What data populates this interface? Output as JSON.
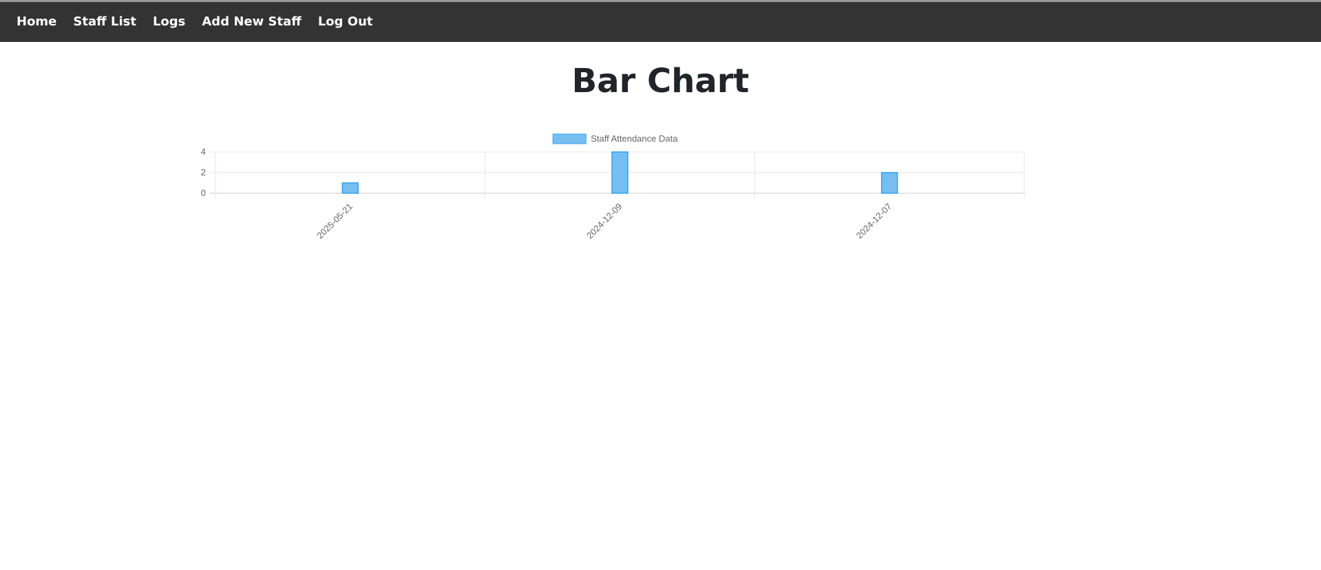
{
  "nav": {
    "items": [
      {
        "id": "home",
        "label": "Home"
      },
      {
        "id": "staff-list",
        "label": "Staff List"
      },
      {
        "id": "logs",
        "label": "Logs"
      },
      {
        "id": "add-new-staff",
        "label": "Add New Staff"
      },
      {
        "id": "log-out",
        "label": "Log Out"
      }
    ]
  },
  "page": {
    "title": "Bar Chart"
  },
  "colors": {
    "navbar_bg": "#333333",
    "bar_fill": "#76bdf0",
    "bar_stroke": "#36a2eb",
    "grid": "#e5e5e5",
    "axis_text": "#666666"
  },
  "chart_data": {
    "type": "bar",
    "categories": [
      "2025-05-21",
      "2024-12-09",
      "2024-12-07"
    ],
    "series": [
      {
        "name": "Staff Attendance Data",
        "values": [
          1,
          4,
          2
        ]
      }
    ],
    "ylim": [
      0,
      4
    ],
    "yticks": [
      0,
      2,
      4
    ],
    "legend": "top-center",
    "grid": true,
    "x_tick_rotation": -45
  }
}
